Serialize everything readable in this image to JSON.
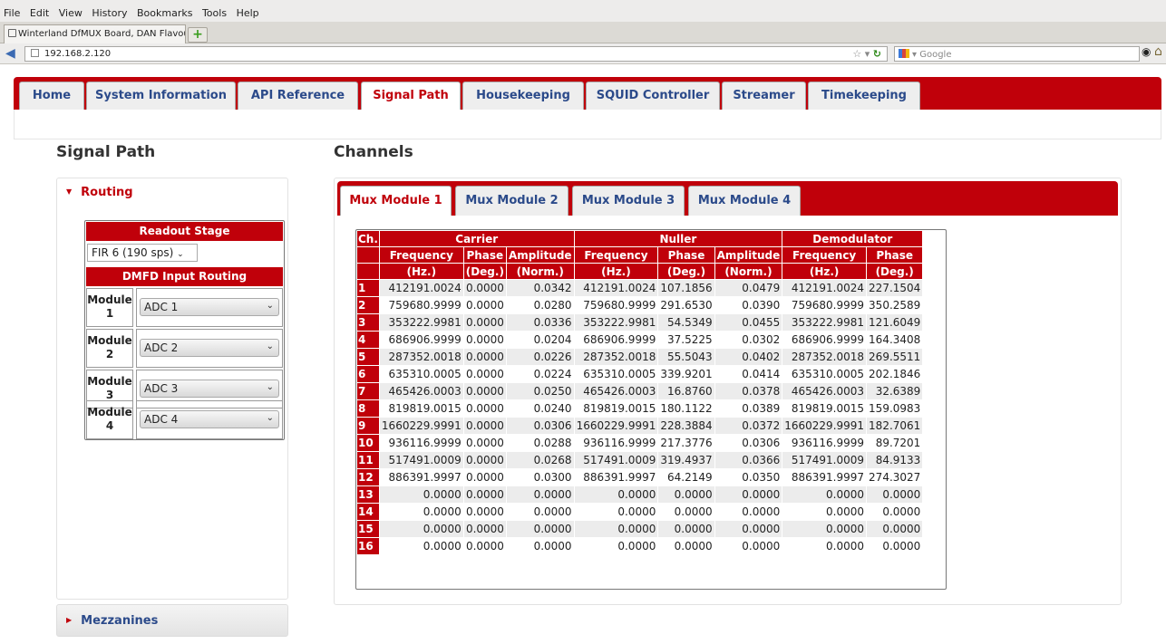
{
  "browser": {
    "menu": [
      "File",
      "Edit",
      "View",
      "History",
      "Bookmarks",
      "Tools",
      "Help"
    ],
    "tab_title": "Winterland DfMUX Board, DAN Flavour",
    "new_tab": "+",
    "url": "192.168.2.120",
    "search_placeholder": "Google"
  },
  "site_nav": [
    "Home",
    "System Information",
    "API Reference",
    "Signal Path",
    "Housekeeping",
    "SQUID Controller",
    "Streamer",
    "Timekeeping"
  ],
  "site_nav_active": "Signal Path",
  "sidebar": {
    "title": "Signal Path",
    "routing_label": "Routing",
    "readout_stage_header": "Readout Stage",
    "readout_stage_value": "FIR 6 (190 sps)",
    "dmfd_header": "DMFD Input Routing",
    "modules": [
      {
        "label_word": "Module",
        "label_num": "1",
        "value": "ADC 1"
      },
      {
        "label_word": "Module",
        "label_num": "2",
        "value": "ADC 2"
      },
      {
        "label_word": "Module",
        "label_num": "3",
        "value": "ADC 3"
      },
      {
        "label_word": "Module",
        "label_num": "4",
        "value": "ADC 4"
      }
    ],
    "mezzanines_label": "Mezzanines"
  },
  "channels": {
    "title": "Channels",
    "mux_tabs": [
      "Mux Module 1",
      "Mux Module 2",
      "Mux Module 3",
      "Mux Module 4"
    ],
    "mux_active": "Mux Module 1",
    "table": {
      "ch_header": "Ch.",
      "groups": [
        "Carrier",
        "Nuller",
        "Demodulator"
      ],
      "subheaders": [
        "Frequency",
        "Phase",
        "Amplitude",
        "Frequency",
        "Phase",
        "Amplitude",
        "Frequency",
        "Phase"
      ],
      "units": [
        "(Hz.)",
        "(Deg.)",
        "(Norm.)",
        "(Hz.)",
        "(Deg.)",
        "(Norm.)",
        "(Hz.)",
        "(Deg.)"
      ],
      "rows": [
        [
          "1",
          "412191.0024",
          "0.0000",
          "0.0342",
          "412191.0024",
          "107.1856",
          "0.0479",
          "412191.0024",
          "227.1504"
        ],
        [
          "2",
          "759680.9999",
          "0.0000",
          "0.0280",
          "759680.9999",
          "291.6530",
          "0.0390",
          "759680.9999",
          "350.2589"
        ],
        [
          "3",
          "353222.9981",
          "0.0000",
          "0.0336",
          "353222.9981",
          "54.5349",
          "0.0455",
          "353222.9981",
          "121.6049"
        ],
        [
          "4",
          "686906.9999",
          "0.0000",
          "0.0204",
          "686906.9999",
          "37.5225",
          "0.0302",
          "686906.9999",
          "164.3408"
        ],
        [
          "5",
          "287352.0018",
          "0.0000",
          "0.0226",
          "287352.0018",
          "55.5043",
          "0.0402",
          "287352.0018",
          "269.5511"
        ],
        [
          "6",
          "635310.0005",
          "0.0000",
          "0.0224",
          "635310.0005",
          "339.9201",
          "0.0414",
          "635310.0005",
          "202.1846"
        ],
        [
          "7",
          "465426.0003",
          "0.0000",
          "0.0250",
          "465426.0003",
          "16.8760",
          "0.0378",
          "465426.0003",
          "32.6389"
        ],
        [
          "8",
          "819819.0015",
          "0.0000",
          "0.0240",
          "819819.0015",
          "180.1122",
          "0.0389",
          "819819.0015",
          "159.0983"
        ],
        [
          "9",
          "1660229.9991",
          "0.0000",
          "0.0306",
          "1660229.9991",
          "228.3884",
          "0.0372",
          "1660229.9991",
          "182.7061"
        ],
        [
          "10",
          "936116.9999",
          "0.0000",
          "0.0288",
          "936116.9999",
          "217.3776",
          "0.0306",
          "936116.9999",
          "89.7201"
        ],
        [
          "11",
          "517491.0009",
          "0.0000",
          "0.0268",
          "517491.0009",
          "319.4937",
          "0.0366",
          "517491.0009",
          "84.9133"
        ],
        [
          "12",
          "886391.9997",
          "0.0000",
          "0.0300",
          "886391.9997",
          "64.2149",
          "0.0350",
          "886391.9997",
          "274.3027"
        ],
        [
          "13",
          "0.0000",
          "0.0000",
          "0.0000",
          "0.0000",
          "0.0000",
          "0.0000",
          "0.0000",
          "0.0000"
        ],
        [
          "14",
          "0.0000",
          "0.0000",
          "0.0000",
          "0.0000",
          "0.0000",
          "0.0000",
          "0.0000",
          "0.0000"
        ],
        [
          "15",
          "0.0000",
          "0.0000",
          "0.0000",
          "0.0000",
          "0.0000",
          "0.0000",
          "0.0000",
          "0.0000"
        ],
        [
          "16",
          "0.0000",
          "0.0000",
          "0.0000",
          "0.0000",
          "0.0000",
          "0.0000",
          "0.0000",
          "0.0000"
        ]
      ]
    }
  },
  "colors": {
    "accent": "#c0000a",
    "link": "#2b4a8a"
  }
}
